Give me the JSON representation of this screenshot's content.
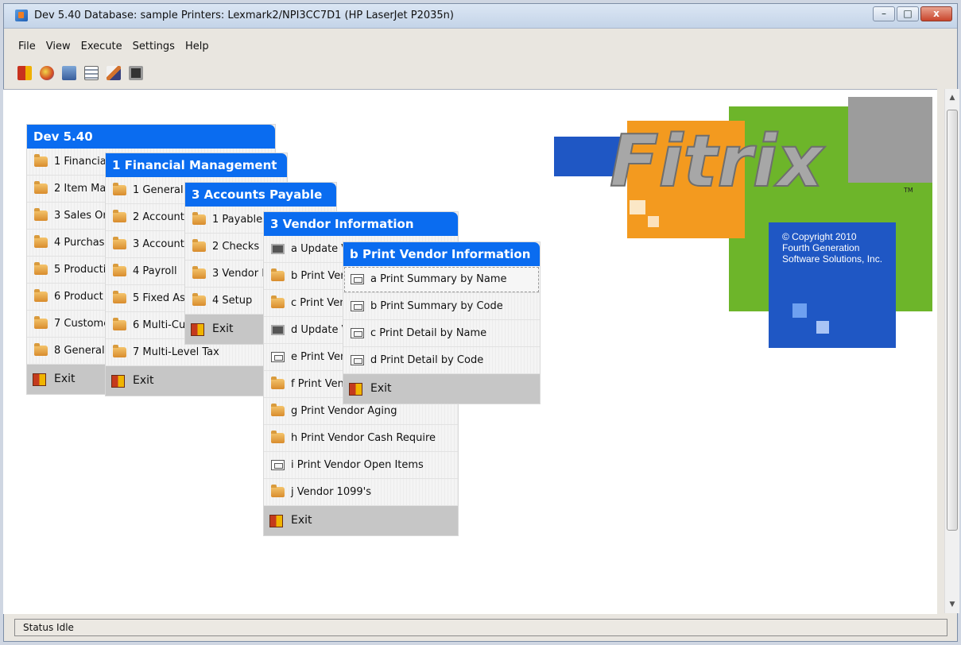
{
  "window": {
    "title": "Dev 5.40 Database: sample Printers: Lexmark2/NPI3CC7D1 (HP LaserJet P2035n)",
    "minimize_label": "–",
    "maximize_label": "□",
    "close_label": "x"
  },
  "menubar": {
    "items": [
      "File",
      "View",
      "Execute",
      "Settings",
      "Help"
    ]
  },
  "toolbar": {
    "icons": [
      "exit-icon",
      "paint-icon",
      "copy-icon",
      "tree-icon",
      "edit-icon",
      "terminal-icon"
    ]
  },
  "menus": {
    "main": {
      "title": "Dev 5.40",
      "items": [
        "1 Financial Management",
        "2 Item Management",
        "3 Sales Order Processing",
        "4 Purchasing",
        "5 Production",
        "6 Product Configuration",
        "7 Customer Relations",
        "8 General"
      ],
      "exit": "Exit"
    },
    "financial": {
      "title": "1 Financial Management",
      "items": [
        "1 General Ledger",
        "2 Accounts Receivable",
        "3 Accounts Payable",
        "4 Payroll",
        "5 Fixed Assets",
        "6 Multi-Currency",
        "7 Multi-Level Tax"
      ],
      "exit": "Exit"
    },
    "ap": {
      "title": "3 Accounts Payable",
      "items": [
        "1 Payables",
        "2 Checks",
        "3 Vendor Information",
        "4 Setup"
      ],
      "exit": "Exit"
    },
    "vendor": {
      "title": "3 Vendor Information",
      "items": [
        "a Update Vendors",
        "b Print Vendor Information",
        "c Print Vendor Labels",
        "d Update Vendor Notes",
        "e Print Vendor Notes",
        "f Print Vendor History",
        "g Print Vendor Aging",
        "h Print Vendor Cash Require",
        "i Print Vendor Open Items",
        "j Vendor 1099's"
      ],
      "exit": "Exit"
    },
    "print_vendor": {
      "title": "b Print Vendor Information",
      "items": [
        "a Print Summary by Name",
        "b Print Summary by Code",
        "c Print Detail by Name",
        "d Print Detail by Code"
      ],
      "exit": "Exit"
    }
  },
  "logo": {
    "brand": "Fitrix",
    "tm": "TM",
    "copyright": "© Copyright 2010",
    "company_line1": "Fourth Generation",
    "company_line2": "Software Solutions, Inc.",
    "colors": {
      "green": "#6db52a",
      "orange": "#f39a1f",
      "blue": "#1f57c4",
      "gray": "#9c9c9c"
    }
  },
  "status": {
    "text": "Status  Idle"
  }
}
